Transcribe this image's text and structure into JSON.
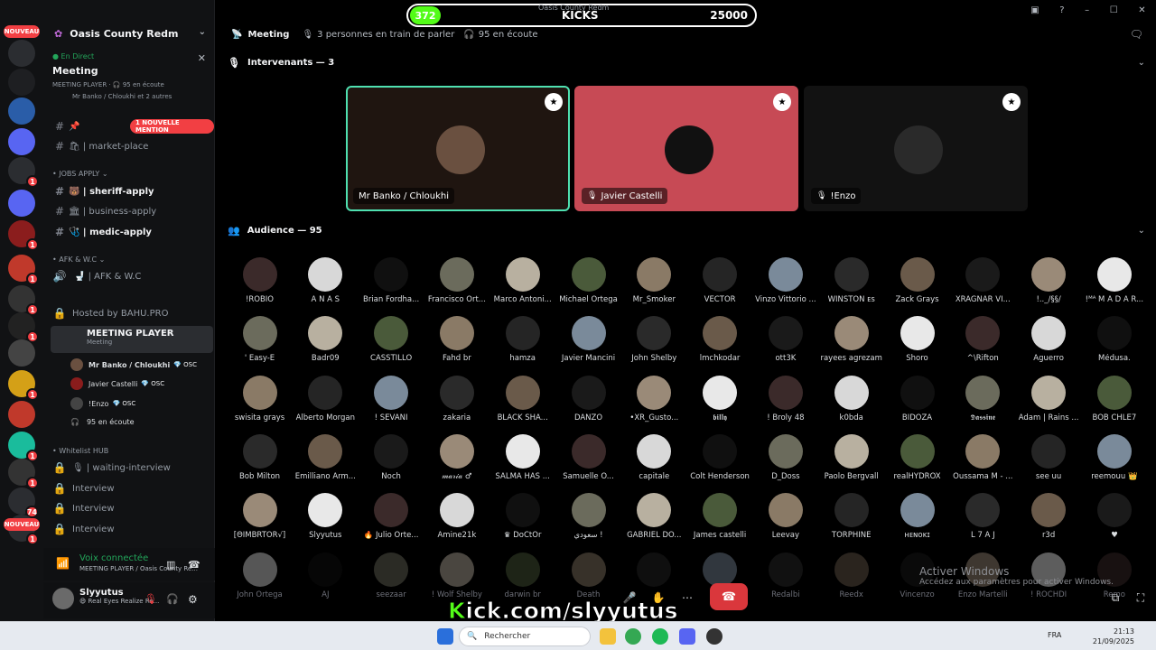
{
  "rail": {
    "new_badge": "NOUVEAU",
    "servers": [
      {
        "label": "",
        "badge": ""
      },
      {
        "label": "",
        "badge": ""
      },
      {
        "label": "",
        "badge": ""
      },
      {
        "label": "",
        "badge": ""
      },
      {
        "label": "",
        "badge": "1"
      },
      {
        "label": "",
        "badge": ""
      },
      {
        "label": "",
        "badge": "1"
      },
      {
        "label": "",
        "badge": "1"
      },
      {
        "label": "",
        "badge": "1"
      },
      {
        "label": "",
        "badge": "1"
      },
      {
        "label": "",
        "badge": ""
      },
      {
        "label": "",
        "badge": "1"
      },
      {
        "label": "",
        "badge": ""
      },
      {
        "label": "",
        "badge": "1"
      },
      {
        "label": "",
        "badge": "1"
      },
      {
        "label": "",
        "badge": "74"
      },
      {
        "label": "",
        "badge": "1"
      }
    ]
  },
  "sidebar": {
    "guild_name": "Oasis County Redm",
    "live": {
      "tag": "En Direct",
      "title": "Meeting",
      "sub": "MEETING PLAYER · 🎧 95 en écoute",
      "speakers": "Mr Banko / Chloukhi et 2 autres"
    },
    "mention_badge": "1 NOUVELLE MENTION",
    "channels_top": [
      {
        "name": "📌",
        "unread": false
      },
      {
        "name": "🛍 | market-place",
        "unread": false
      }
    ],
    "cat_jobs": "JOBS APPLY",
    "channels_jobs": [
      {
        "name": "🐻 | sheriff-apply",
        "unread": true
      },
      {
        "name": "🏛 | business-apply",
        "unread": false
      },
      {
        "name": "🩺 | medic-apply",
        "unread": true
      }
    ],
    "cat_afk": "AFK & W.C",
    "afk_channel": "🚽 | AFK & W.C",
    "hosted": "Hosted by BAHU.PRO",
    "voice_channel": {
      "name": "MEETING PLAYER",
      "sub": "Meeting"
    },
    "voice_users": [
      {
        "name": "Mr Banko / Chloukhi",
        "tag": "💎 OSC"
      },
      {
        "name": "Javier Castelli",
        "tag": "💎 OSC"
      },
      {
        "name": "!Enzo",
        "tag": "💎 OSC"
      }
    ],
    "listeners": "95 en écoute",
    "cat_whitelist": "Whitelist HUB",
    "channels_wl": [
      "🎙 | waiting-interview",
      "Interview",
      "Interview",
      "Interview"
    ],
    "voice_connected": "Voix connectée",
    "voice_location": "MEETING PLAYER / Oasis County Re...",
    "user": {
      "name": "Slyyutus",
      "status": "😄 Real Eyes Realize Re..."
    }
  },
  "main": {
    "title": "Meeting",
    "speaking": "3 personnes en train de parler",
    "listening": "95 en écoute",
    "speakers_header": "Intervenants — 3",
    "audience_header": "Audience — 95",
    "speakers": [
      {
        "name": "Mr Banko / Chloukhi",
        "bg": "#1f1510",
        "border": "#4fe0b0",
        "muted": false
      },
      {
        "name": "Javier Castelli",
        "bg": "#c74a55",
        "border": "#c74a55",
        "muted": true
      },
      {
        "name": "!Enzo",
        "bg": "#121212",
        "border": "#121212",
        "muted": true
      }
    ],
    "audience": [
      "!ROBIO",
      "A N A S",
      "Brian Fordha...",
      "Francisco Ort...",
      "Marco Antoni...",
      "Michael Ortega",
      "Mr_Smoker",
      "VECTOR",
      "Vinzo Vittorio ...",
      "WINSTON ᴇs",
      "Zack Grays",
      "XRAGNAR VI...",
      "!.._/§§/",
      "!ᴹᴬ M A D A R...",
      "' Easy-E",
      "Badr09",
      "CASSTILLO",
      "Fahd br",
      "hamza",
      "Javier Mancini",
      "John Shelby",
      "lmchkodar",
      "ott3K",
      "rayees agrezam",
      "Shoro",
      "^\\Rifton",
      "Aguerro",
      "Médusa.",
      "swisita grays",
      "Alberto Morgan",
      "! SEVANI",
      "zakaria",
      "BLACK SHA...",
      "DANZO",
      "•XR_Gusto...",
      "𝖇𝖎𝖑𝖑𝖞",
      "! Broly 48",
      "k0bda",
      "BIDOZA",
      "𝕯𝖆𝖘𝖘𝖎𝖓𝖊",
      "Adam | Rains ...",
      "BOB CHLE7",
      "Bob Milton",
      "Emilliano Arm...",
      "Noch",
      "𝓂𝒶𝓇𝒾𝒶 ♂",
      "SALMA HAS ...",
      "Samuelle O...",
      "capitale",
      "Colt Henderson",
      "D_Doss",
      "Paolo Bergvall",
      "realHYDROX",
      "Oussama M - ...",
      "see uu",
      "reemouu 👑",
      "[ΘIMBRTOR√]",
      "Slyyutus",
      "🔥 Julio Orte...",
      "Amine21k",
      "♛ DoCtOr",
      "سعودي !",
      "GABRIEL DO...",
      "James castelli",
      "Leevay",
      "TORPHINE",
      "ʜᴇɴᴏᴋɪ",
      "L 7 A J",
      "r3d",
      "♥",
      "John Ortega",
      "AJ",
      "seezaar",
      "! Wolf Shelby",
      "darwin br",
      "Death",
      "",
      "",
      "Redalbi",
      "Reedx",
      "Vincenzo",
      "Enzo Martelli",
      "! ROCHDI",
      "Remo"
    ],
    "audience_colors": [
      "#3b2a2a",
      "#6b6b5c",
      "#8a7a66",
      "#2a2a2a",
      "#9a8a78",
      "#d8d8d8",
      "#b8b0a0",
      "#252525",
      "#6a5a4a",
      "#e8e8e8",
      "#101010",
      "#4a5a3a",
      "#7a8a9a",
      "#1a1a1a"
    ]
  },
  "overlay": {
    "kicks_count": "372",
    "kicks_label": "KICKS",
    "kicks_score": "25000",
    "window_title": "Oasis County Redm",
    "kick_link_k": "K",
    "kick_link": "ick.com/slyyutus",
    "activate_title": "Activer Windows",
    "activate_sub": "Accédez aux paramètres pour activer Windows."
  },
  "taskbar": {
    "search": "Rechercher",
    "lang": "FRA",
    "time": "21:13",
    "date": "21/09/2025"
  }
}
